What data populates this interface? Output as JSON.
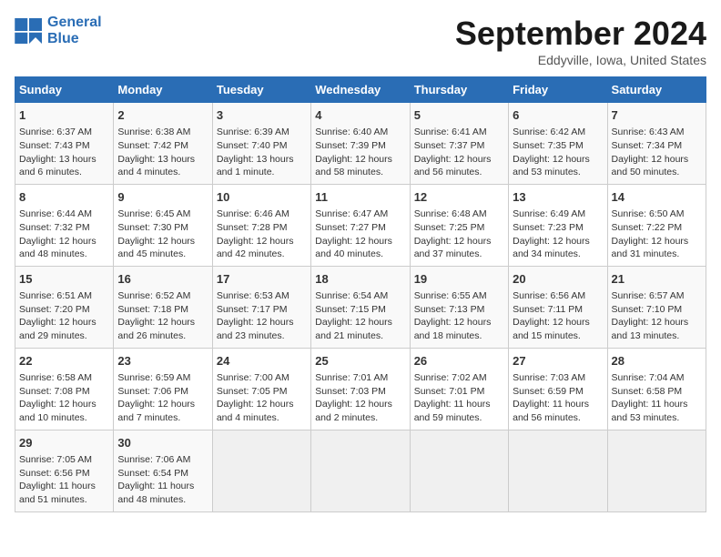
{
  "header": {
    "logo_line1": "General",
    "logo_line2": "Blue",
    "month_year": "September 2024",
    "location": "Eddyville, Iowa, United States"
  },
  "days_of_week": [
    "Sunday",
    "Monday",
    "Tuesday",
    "Wednesday",
    "Thursday",
    "Friday",
    "Saturday"
  ],
  "weeks": [
    [
      {
        "day": "1",
        "info": "Sunrise: 6:37 AM\nSunset: 7:43 PM\nDaylight: 13 hours and 6 minutes."
      },
      {
        "day": "2",
        "info": "Sunrise: 6:38 AM\nSunset: 7:42 PM\nDaylight: 13 hours and 4 minutes."
      },
      {
        "day": "3",
        "info": "Sunrise: 6:39 AM\nSunset: 7:40 PM\nDaylight: 13 hours and 1 minute."
      },
      {
        "day": "4",
        "info": "Sunrise: 6:40 AM\nSunset: 7:39 PM\nDaylight: 12 hours and 58 minutes."
      },
      {
        "day": "5",
        "info": "Sunrise: 6:41 AM\nSunset: 7:37 PM\nDaylight: 12 hours and 56 minutes."
      },
      {
        "day": "6",
        "info": "Sunrise: 6:42 AM\nSunset: 7:35 PM\nDaylight: 12 hours and 53 minutes."
      },
      {
        "day": "7",
        "info": "Sunrise: 6:43 AM\nSunset: 7:34 PM\nDaylight: 12 hours and 50 minutes."
      }
    ],
    [
      {
        "day": "8",
        "info": "Sunrise: 6:44 AM\nSunset: 7:32 PM\nDaylight: 12 hours and 48 minutes."
      },
      {
        "day": "9",
        "info": "Sunrise: 6:45 AM\nSunset: 7:30 PM\nDaylight: 12 hours and 45 minutes."
      },
      {
        "day": "10",
        "info": "Sunrise: 6:46 AM\nSunset: 7:28 PM\nDaylight: 12 hours and 42 minutes."
      },
      {
        "day": "11",
        "info": "Sunrise: 6:47 AM\nSunset: 7:27 PM\nDaylight: 12 hours and 40 minutes."
      },
      {
        "day": "12",
        "info": "Sunrise: 6:48 AM\nSunset: 7:25 PM\nDaylight: 12 hours and 37 minutes."
      },
      {
        "day": "13",
        "info": "Sunrise: 6:49 AM\nSunset: 7:23 PM\nDaylight: 12 hours and 34 minutes."
      },
      {
        "day": "14",
        "info": "Sunrise: 6:50 AM\nSunset: 7:22 PM\nDaylight: 12 hours and 31 minutes."
      }
    ],
    [
      {
        "day": "15",
        "info": "Sunrise: 6:51 AM\nSunset: 7:20 PM\nDaylight: 12 hours and 29 minutes."
      },
      {
        "day": "16",
        "info": "Sunrise: 6:52 AM\nSunset: 7:18 PM\nDaylight: 12 hours and 26 minutes."
      },
      {
        "day": "17",
        "info": "Sunrise: 6:53 AM\nSunset: 7:17 PM\nDaylight: 12 hours and 23 minutes."
      },
      {
        "day": "18",
        "info": "Sunrise: 6:54 AM\nSunset: 7:15 PM\nDaylight: 12 hours and 21 minutes."
      },
      {
        "day": "19",
        "info": "Sunrise: 6:55 AM\nSunset: 7:13 PM\nDaylight: 12 hours and 18 minutes."
      },
      {
        "day": "20",
        "info": "Sunrise: 6:56 AM\nSunset: 7:11 PM\nDaylight: 12 hours and 15 minutes."
      },
      {
        "day": "21",
        "info": "Sunrise: 6:57 AM\nSunset: 7:10 PM\nDaylight: 12 hours and 13 minutes."
      }
    ],
    [
      {
        "day": "22",
        "info": "Sunrise: 6:58 AM\nSunset: 7:08 PM\nDaylight: 12 hours and 10 minutes."
      },
      {
        "day": "23",
        "info": "Sunrise: 6:59 AM\nSunset: 7:06 PM\nDaylight: 12 hours and 7 minutes."
      },
      {
        "day": "24",
        "info": "Sunrise: 7:00 AM\nSunset: 7:05 PM\nDaylight: 12 hours and 4 minutes."
      },
      {
        "day": "25",
        "info": "Sunrise: 7:01 AM\nSunset: 7:03 PM\nDaylight: 12 hours and 2 minutes."
      },
      {
        "day": "26",
        "info": "Sunrise: 7:02 AM\nSunset: 7:01 PM\nDaylight: 11 hours and 59 minutes."
      },
      {
        "day": "27",
        "info": "Sunrise: 7:03 AM\nSunset: 6:59 PM\nDaylight: 11 hours and 56 minutes."
      },
      {
        "day": "28",
        "info": "Sunrise: 7:04 AM\nSunset: 6:58 PM\nDaylight: 11 hours and 53 minutes."
      }
    ],
    [
      {
        "day": "29",
        "info": "Sunrise: 7:05 AM\nSunset: 6:56 PM\nDaylight: 11 hours and 51 minutes."
      },
      {
        "day": "30",
        "info": "Sunrise: 7:06 AM\nSunset: 6:54 PM\nDaylight: 11 hours and 48 minutes."
      },
      {
        "day": "",
        "info": ""
      },
      {
        "day": "",
        "info": ""
      },
      {
        "day": "",
        "info": ""
      },
      {
        "day": "",
        "info": ""
      },
      {
        "day": "",
        "info": ""
      }
    ]
  ]
}
